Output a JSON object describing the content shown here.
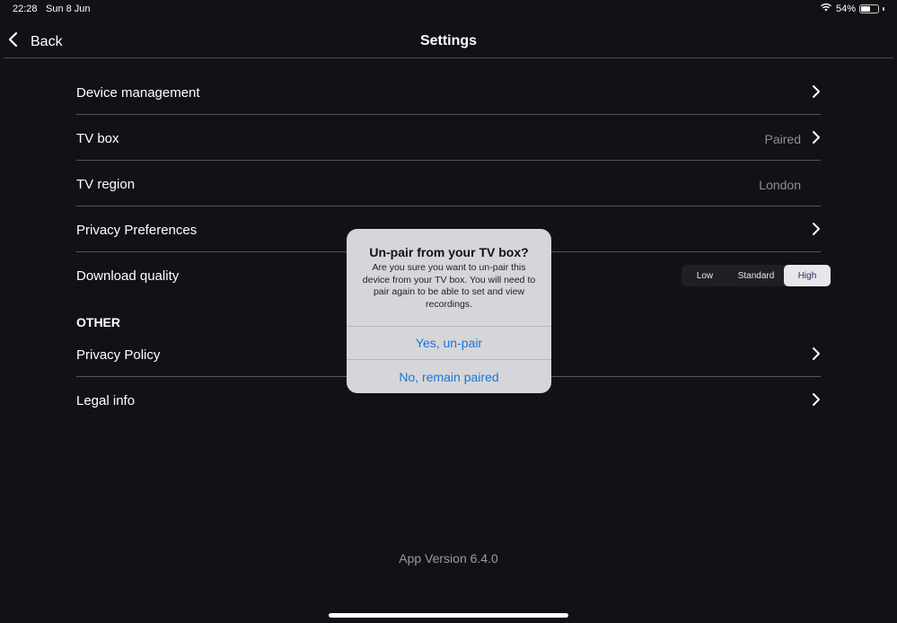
{
  "status_bar": {
    "time": "22:28",
    "date": "Sun 8 Jun",
    "battery_percent": "54%",
    "battery_level": 0.54
  },
  "nav": {
    "back_label": "Back",
    "title": "Settings"
  },
  "settings": {
    "rows": [
      {
        "label": "Device management",
        "value": ""
      },
      {
        "label": "TV box",
        "value": "Paired"
      },
      {
        "label": "TV region",
        "value": "London"
      },
      {
        "label": "Privacy Preferences",
        "value": ""
      },
      {
        "label": "Download quality",
        "value": ""
      }
    ],
    "download_quality": {
      "options": [
        "Low",
        "Standard",
        "High"
      ],
      "selected": "High"
    }
  },
  "other": {
    "header": "OTHER",
    "rows": [
      {
        "label": "Privacy Policy"
      },
      {
        "label": "Legal info"
      }
    ]
  },
  "footer": {
    "version": "App Version 6.4.0"
  },
  "dialog": {
    "title": "Un-pair from your TV box?",
    "message": "Are you sure you want to un-pair this device from your TV box. You will need to pair again to be able to set and view recordings.",
    "confirm_label": "Yes, un-pair",
    "cancel_label": "No, remain paired"
  },
  "colors": {
    "background": "#111116",
    "accent": "#1a76d6",
    "secondary_text": "#8e8e93"
  }
}
